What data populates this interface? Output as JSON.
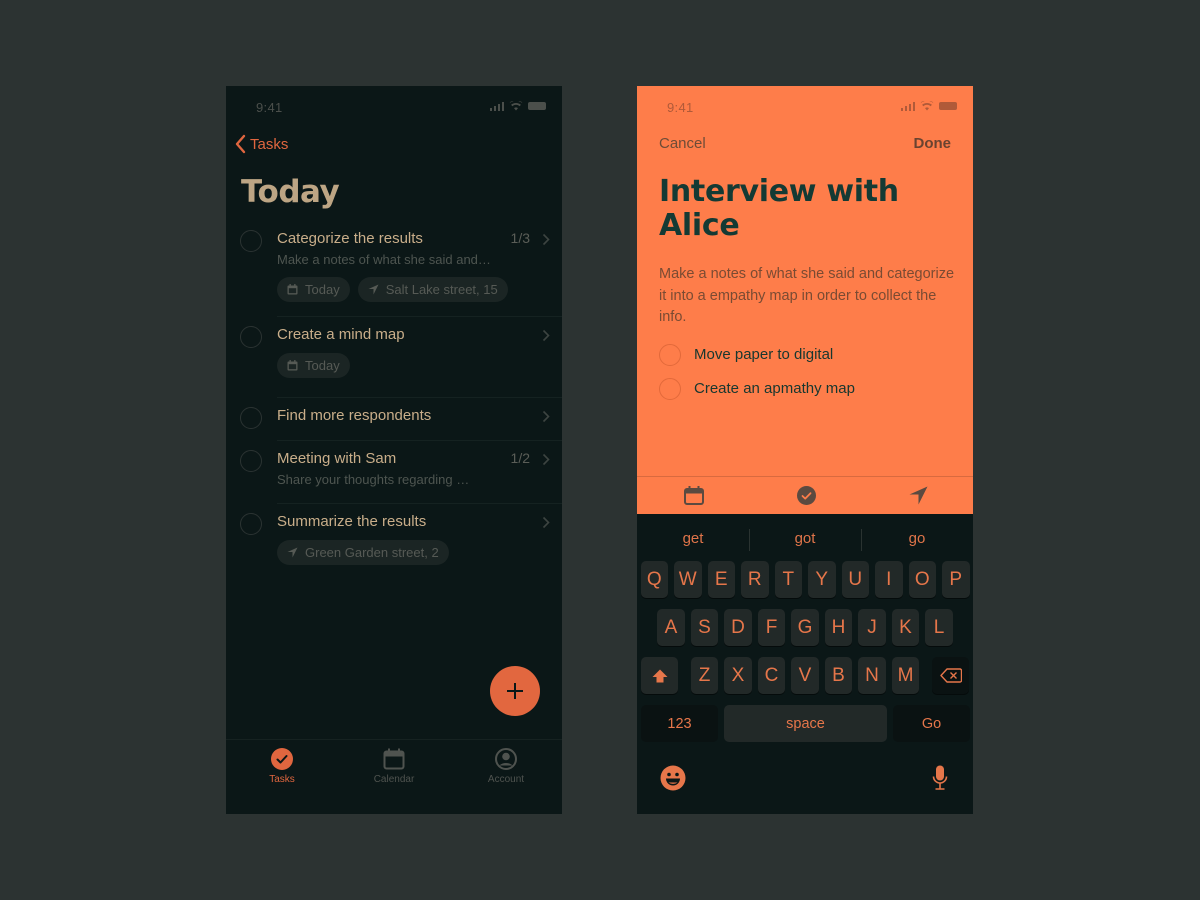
{
  "colors": {
    "background": "#2c3332",
    "phone_dark": "#0b1717",
    "accent": "#e2673f",
    "detail_orange": "#fe7d4a",
    "title_tan": "#bda584",
    "detail_title": "#143a34"
  },
  "list_screen": {
    "status_time": "9:41",
    "back_label": "Tasks",
    "title": "Today",
    "tasks": [
      {
        "title": "Categorize the results",
        "subtitle": "Make a notes of what she said and…",
        "count": "1/3",
        "chips": [
          {
            "icon": "calendar-icon",
            "label": "Today"
          },
          {
            "icon": "location-arrow-icon",
            "label": "Salt Lake street, 15"
          }
        ]
      },
      {
        "title": "Create a mind map",
        "chips": [
          {
            "icon": "calendar-icon",
            "label": "Today"
          }
        ]
      },
      {
        "title": "Find more respondents"
      },
      {
        "title": "Meeting with Sam",
        "subtitle": "Share your thoughts regarding …",
        "count": "1/2"
      },
      {
        "title": "Summarize the results",
        "chips": [
          {
            "icon": "location-arrow-icon",
            "label": "Green Garden street, 2"
          }
        ]
      }
    ],
    "fab_icon": "plus-icon",
    "tabbar": [
      {
        "label": "Tasks",
        "icon": "check-circle-icon",
        "active": true
      },
      {
        "label": "Calendar",
        "icon": "calendar-icon",
        "active": false
      },
      {
        "label": "Account",
        "icon": "account-icon",
        "active": false
      }
    ]
  },
  "detail_screen": {
    "status_time": "9:41",
    "cancel_label": "Cancel",
    "done_label": "Done",
    "title": "Interview with Alice",
    "description": "Make a notes of what she said and categorize it into a empathy map in order to collect the info.",
    "subtasks": [
      {
        "label": "Move paper to digital",
        "done": false
      },
      {
        "label": "Create an apmathy map",
        "done": false
      }
    ],
    "accessory_icons": [
      "calendar-icon",
      "check-circle-icon",
      "location-arrow-icon"
    ],
    "keyboard": {
      "suggestions": [
        "get",
        "got",
        "go"
      ],
      "row1": [
        "Q",
        "W",
        "E",
        "R",
        "T",
        "Y",
        "U",
        "I",
        "O",
        "P"
      ],
      "row2": [
        "A",
        "S",
        "D",
        "F",
        "G",
        "H",
        "J",
        "K",
        "L"
      ],
      "row3": [
        "Z",
        "X",
        "C",
        "V",
        "B",
        "N",
        "M"
      ],
      "numbers_key": "123",
      "space_key": "space",
      "return_key": "Go"
    }
  }
}
